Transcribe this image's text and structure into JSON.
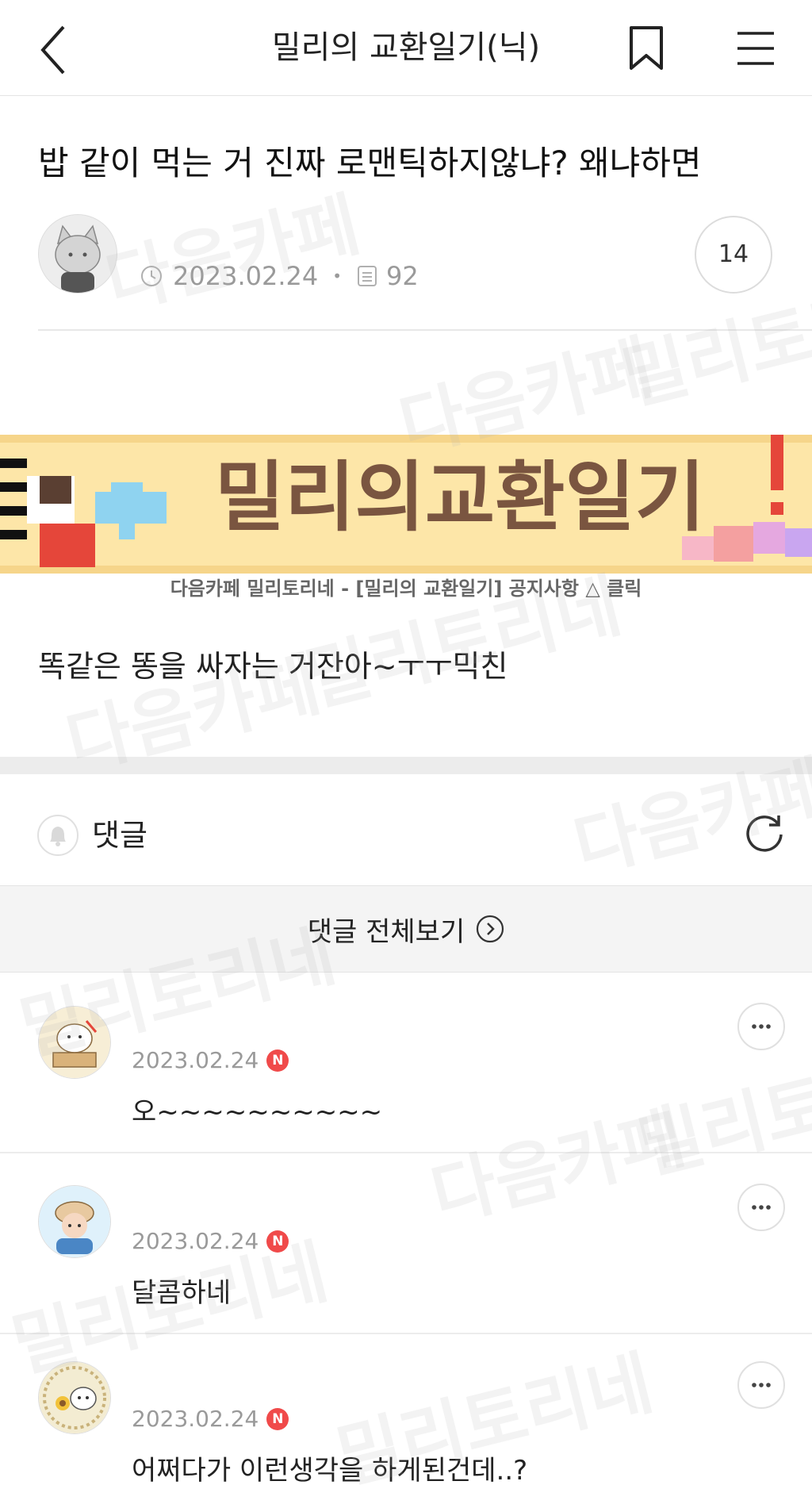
{
  "header": {
    "title": "밀리의 교환일기(닉)"
  },
  "post": {
    "title": "밥 같이 먹는 거 진짜 로맨틱하지않냐? 왜냐하면",
    "date": "2023.02.24",
    "views": "92",
    "comment_count": "14",
    "banner_text": "밀리의교환일기",
    "banner_caption": "다음카페 밀리토리네 - [밀리의 교환일기] 공지사항 △ 클릭",
    "body": "똑같은 똥을 싸자는 거잔아~ㅜㅜ믹친"
  },
  "comments_section": {
    "label": "댓글",
    "view_all_label": "댓글 전체보기",
    "items": [
      {
        "date": "2023.02.24",
        "badge": "N",
        "text": "오~~~~~~~~~~"
      },
      {
        "date": "2023.02.24",
        "badge": "N",
        "text": "달콤하네"
      },
      {
        "date": "2023.02.24",
        "badge": "N",
        "text": "어쩌다가 이런생각을 하게된건데..?"
      }
    ]
  },
  "watermark": {
    "line1": "다음카페",
    "line2": "밀리토리네"
  },
  "colors": {
    "accent_red": "#f04a4a",
    "banner_bg": "#fde6a8",
    "banner_text": "#7a5540"
  },
  "icons": [
    "back-icon",
    "bookmark-icon",
    "menu-icon",
    "clock-icon",
    "document-icon",
    "bell-icon",
    "refresh-icon",
    "chevron-right-icon",
    "more-icon"
  ]
}
